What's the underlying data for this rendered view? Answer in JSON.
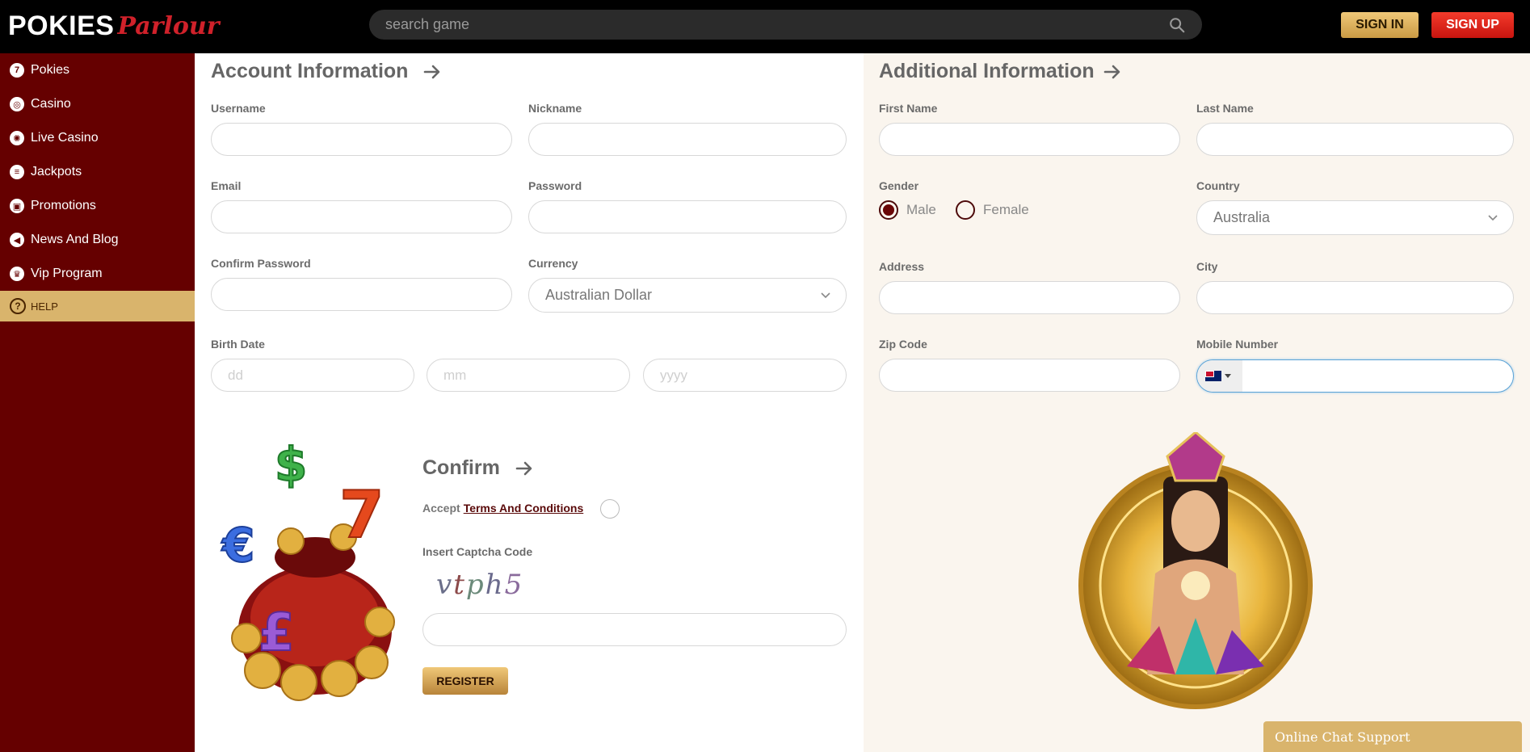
{
  "header": {
    "logo_main": "POKIES",
    "logo_script": "Parlour",
    "search_placeholder": "search game",
    "signin_label": "SIGN IN",
    "signup_label": "SIGN UP"
  },
  "sidebar": {
    "items": [
      {
        "label": "Pokies",
        "icon": "seven-icon"
      },
      {
        "label": "Casino",
        "icon": "chip-icon"
      },
      {
        "label": "Live Casino",
        "icon": "roulette-icon"
      },
      {
        "label": "Jackpots",
        "icon": "jackpot-icon"
      },
      {
        "label": "Promotions",
        "icon": "gift-icon"
      },
      {
        "label": "News And Blog",
        "icon": "megaphone-icon"
      },
      {
        "label": "Vip Program",
        "icon": "crown-icon"
      }
    ],
    "help_label": "HELP"
  },
  "account": {
    "title": "Account Information",
    "username_label": "Username",
    "nickname_label": "Nickname",
    "email_label": "Email",
    "password_label": "Password",
    "confirm_password_label": "Confirm Password",
    "currency_label": "Currency",
    "currency_value": "Australian Dollar",
    "birth_date_label": "Birth Date",
    "dd_placeholder": "dd",
    "mm_placeholder": "mm",
    "yyyy_placeholder": "yyyy"
  },
  "additional": {
    "title": "Additional Information",
    "first_name_label": "First Name",
    "last_name_label": "Last Name",
    "gender_label": "Gender",
    "gender_options": [
      "Male",
      "Female"
    ],
    "gender_selected": "Male",
    "country_label": "Country",
    "country_value": "Australia",
    "address_label": "Address",
    "city_label": "City",
    "zip_label": "Zip Code",
    "mobile_label": "Mobile Number"
  },
  "confirm": {
    "title": "Confirm",
    "accept_text": "Accept",
    "terms_link": "Terms And Conditions",
    "captcha_label": "Insert Captcha Code",
    "captcha_code": [
      "v",
      "t",
      "p",
      "h",
      "5"
    ],
    "register_label": "REGISTER"
  },
  "chat": {
    "label": "Online Chat Support"
  },
  "colors": {
    "sidebar_bg": "#650000",
    "accent_gold": "#d9b46c",
    "signup_red": "#e42119"
  }
}
